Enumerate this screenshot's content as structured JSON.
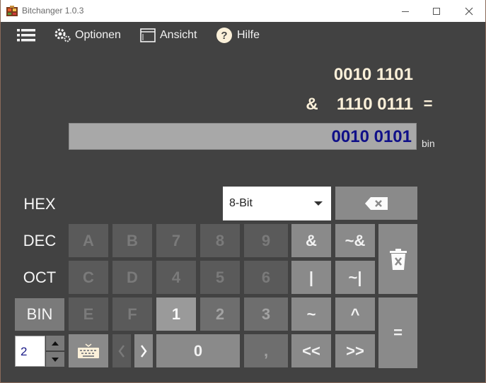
{
  "window": {
    "title": "Bitchanger 1.0.3"
  },
  "toolbar": {
    "menu_icon": "hamburger-icon",
    "options": "Optionen",
    "view": "Ansicht",
    "help": "Hilfe"
  },
  "display": {
    "operand1": "0010 1101",
    "operator": "&",
    "operand2": "1110 0111",
    "equals": "=",
    "result": "0010 0101",
    "result_suffix": "bin"
  },
  "bases": {
    "hex": "HEX",
    "dec": "DEC",
    "oct": "OCT",
    "bin": "BIN",
    "active": "BIN"
  },
  "bit_select": {
    "value": "8-Bit"
  },
  "keys": {
    "A": "A",
    "B": "B",
    "C": "C",
    "D": "D",
    "E": "E",
    "F": "F",
    "n0": "0",
    "n1": "1",
    "n2": "2",
    "n3": "3",
    "n4": "4",
    "n5": "5",
    "n6": "6",
    "n7": "7",
    "n8": "8",
    "n9": "9",
    "and": "&",
    "nand": "~&",
    "or": "|",
    "nor": "~|",
    "not": "~",
    "xor": "^",
    "comma": ",",
    "shl": "<<",
    "shr": ">>",
    "equals": "=",
    "prev": "<",
    "next": ">"
  },
  "spinner": {
    "value": "2"
  },
  "colors": {
    "background": "#424242",
    "result_text": "#101088",
    "display_text": "#fbf0d9"
  }
}
